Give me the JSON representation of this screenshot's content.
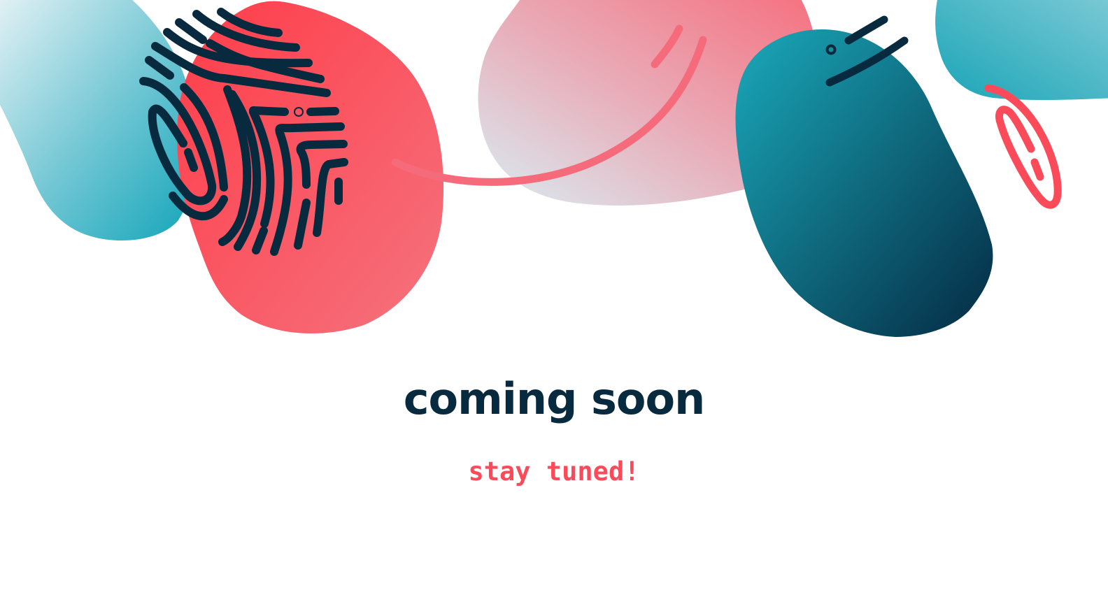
{
  "headline": "coming soon",
  "tagline": "stay tuned!",
  "colors": {
    "navy": "#082a3f",
    "coral": "#fb4b5a",
    "teal": "#1da2b5",
    "background": "#ffffff"
  },
  "decorations": [
    "fingerprint-icon",
    "smile-arc",
    "eyes-dash-marks",
    "red-oval-loop"
  ]
}
